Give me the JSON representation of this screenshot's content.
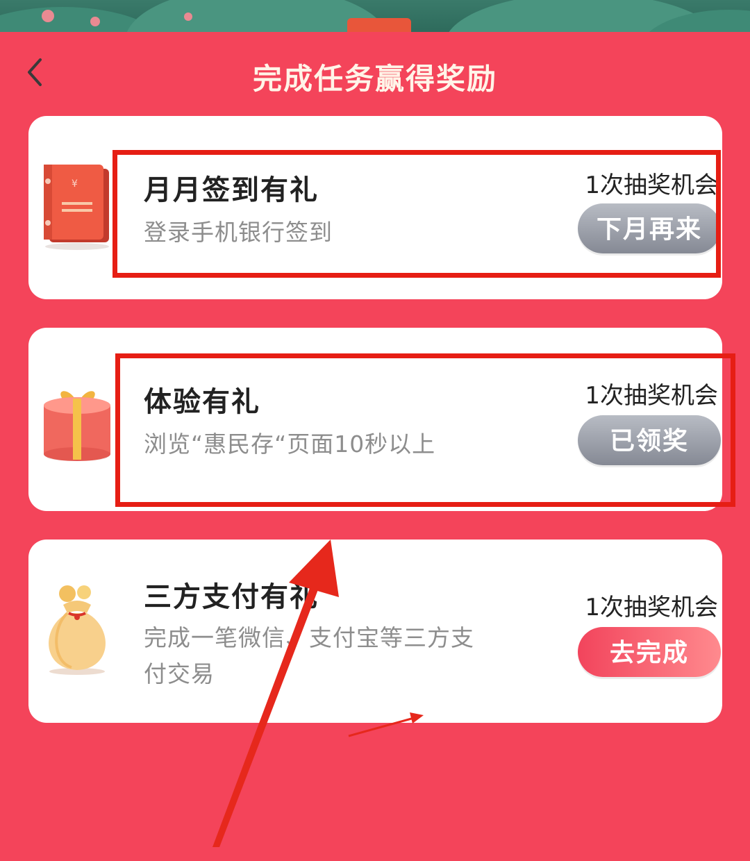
{
  "header": {
    "title": "完成任务赢得奖励"
  },
  "tasks": [
    {
      "title": "月月签到有礼",
      "description": "登录手机银行签到",
      "reward": "1次抽奖机会",
      "button_label": "下月再来",
      "button_state": "disabled",
      "icon": "red-book-icon"
    },
    {
      "title": "体验有礼",
      "description": "浏览“惠民存“页面10秒以上",
      "reward": "1次抽奖机会",
      "button_label": "已领奖",
      "button_state": "disabled",
      "icon": "gift-box-icon"
    },
    {
      "title": "三方支付有礼",
      "description": "完成一笔微信、支付宝等三方支付交易",
      "reward": "1次抽奖机会",
      "button_label": "去完成",
      "button_state": "active",
      "icon": "money-bag-icon"
    }
  ],
  "colors": {
    "background": "#f4445a",
    "card": "#ffffff",
    "annotation": "#e61e14",
    "button_disabled": "#9a9ea7",
    "button_active": "#f2445c",
    "title": "#fff4e8"
  }
}
